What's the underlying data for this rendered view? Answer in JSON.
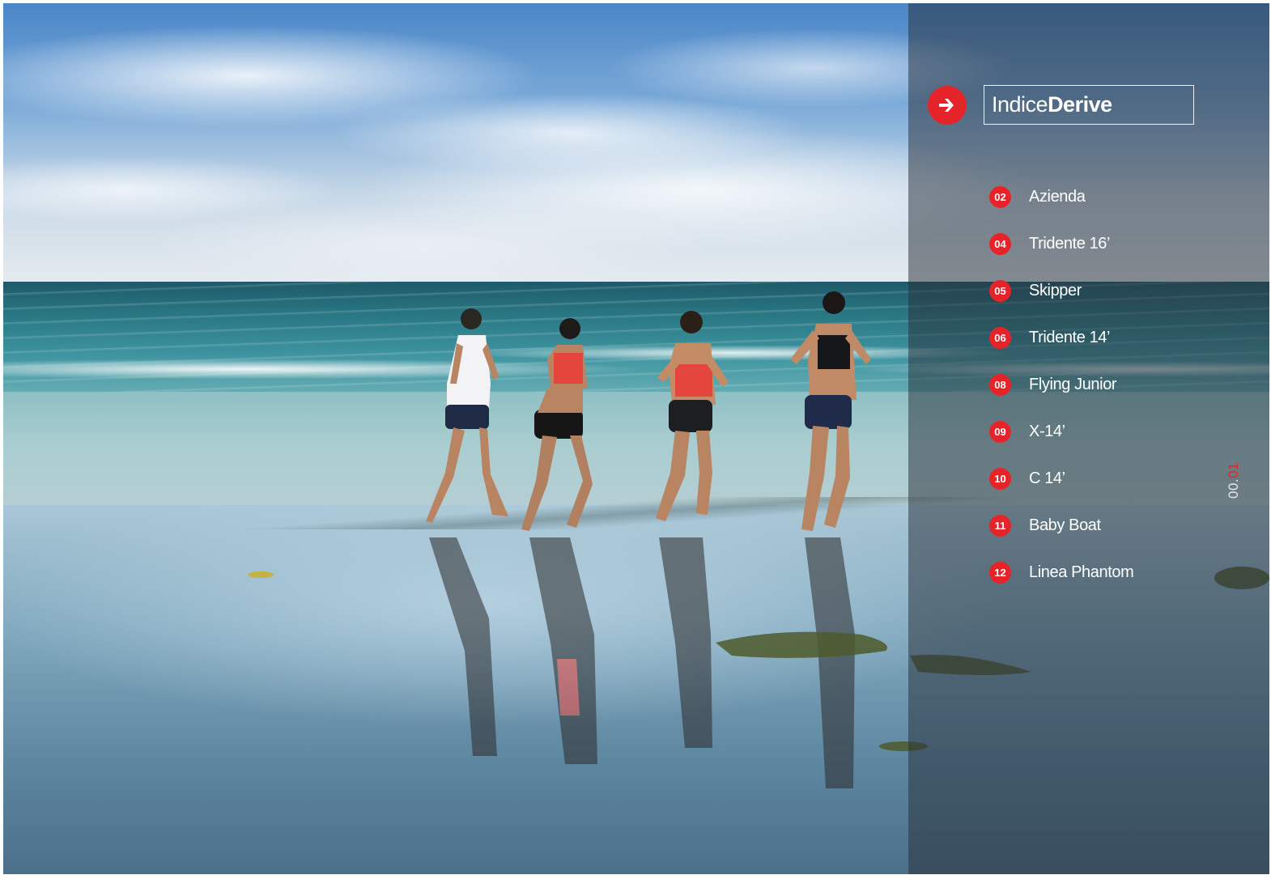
{
  "panel": {
    "title_light": "Indice",
    "title_bold": "Derive",
    "menu": [
      {
        "num": "02",
        "label": "Azienda"
      },
      {
        "num": "04",
        "label": "Tridente 16’"
      },
      {
        "num": "05",
        "label": "Skipper"
      },
      {
        "num": "06",
        "label": "Tridente 14’"
      },
      {
        "num": "08",
        "label": "Flying Junior"
      },
      {
        "num": "09",
        "label": "X-14’"
      },
      {
        "num": "10",
        "label": "C 14’"
      },
      {
        "num": "11",
        "label": "Baby Boat"
      },
      {
        "num": "12",
        "label": "Linea Phantom"
      }
    ],
    "page_code_a": "00.",
    "page_code_b": "01"
  },
  "colors": {
    "accent": "#e52429",
    "panel": "#28303a"
  },
  "icons": {
    "arrow": "arrow-right-icon"
  }
}
